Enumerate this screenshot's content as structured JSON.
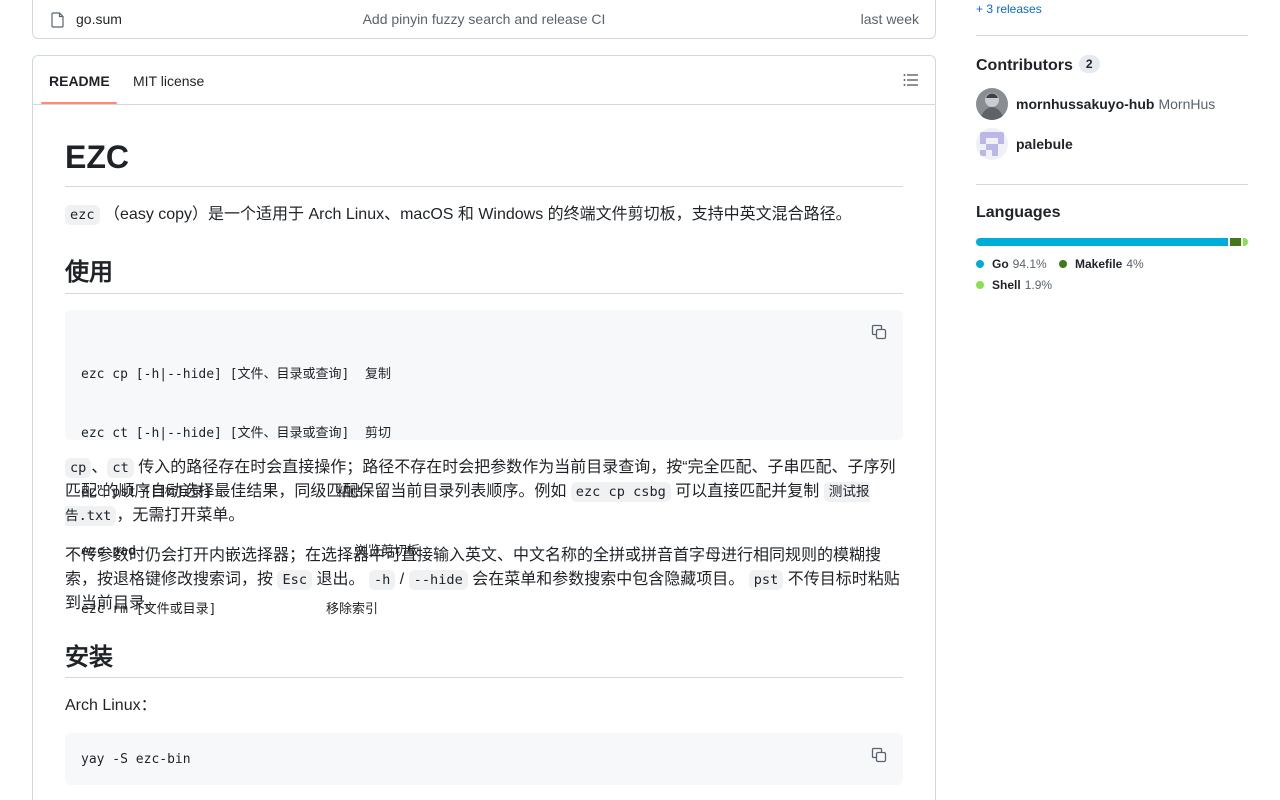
{
  "file_row": {
    "name": "go.sum",
    "commit_message": "Add pinyin fuzzy search and release CI",
    "time": "last week"
  },
  "readme_tabs": {
    "readme": "README",
    "license": "MIT license"
  },
  "readme": {
    "title": "EZC",
    "intro_code": "ezc",
    "intro_text": "（easy copy）是一个适用于 Arch Linux、macOS 和 Windows 的终端文件剪切板，支持中英文混合路径。",
    "h2_usage": "使用",
    "usage_code_lines": [
      "ezc cp [-h|--hide] [文件、目录或查询]  复制",
      "ezc ct [-h|--hide] [文件、目录或查询]  剪切",
      "ezc pst [目标目录]                粘贴",
      "ezc pad                            浏览剪切板",
      "ezc rm [文件或目录]              移除索引"
    ],
    "para1": {
      "code_cp": "cp",
      "sep": "、",
      "code_ct": "ct",
      "text_a": "传入的路径存在时会直接操作；路径不存在时会把参数作为当前目录查询，按“完全匹配、子串匹配、子序列匹配”的顺序自动选择最佳结果，同级匹配保留当前目录列表顺序。例如",
      "code_example": "ezc cp csbg",
      "text_b": "可以直接匹配并复制",
      "code_file": "测试报告.txt",
      "text_c": "，无需打开菜单。"
    },
    "para2": {
      "text_a": "不传参数时仍会打开内嵌选择器；在选择器中可直接输入英文、中文名称的全拼或拼音首字母进行相同规则的模糊搜索，按退格键修改搜索词，按",
      "code_esc": "Esc",
      "text_b": "退出。",
      "code_h": "-h",
      "slash": " / ",
      "code_hide": "--hide",
      "text_c": "会在菜单和参数搜索中包含隐藏项目。",
      "code_pst": "pst",
      "text_d": "不传目标时粘贴到当前目录。"
    },
    "h2_install": "安装",
    "arch_label": "Arch Linux：",
    "install_code": "yay -S ezc-bin"
  },
  "sidebar": {
    "releases_link": "+ 3 releases",
    "contributors_title": "Contributors",
    "contributors_count": "2",
    "contributors": [
      {
        "login": "mornhussakuyo-hub",
        "name": "MornHus"
      },
      {
        "login": "palebule",
        "name": ""
      }
    ],
    "languages_title": "Languages",
    "languages": [
      {
        "name": "Go",
        "pct": "94.1%",
        "value": 94.1,
        "color": "#00add8"
      },
      {
        "name": "Makefile",
        "pct": "4%",
        "value": 4.0,
        "color": "#427819"
      },
      {
        "name": "Shell",
        "pct": "1.9%",
        "value": 1.9,
        "color": "#89e051"
      }
    ]
  }
}
